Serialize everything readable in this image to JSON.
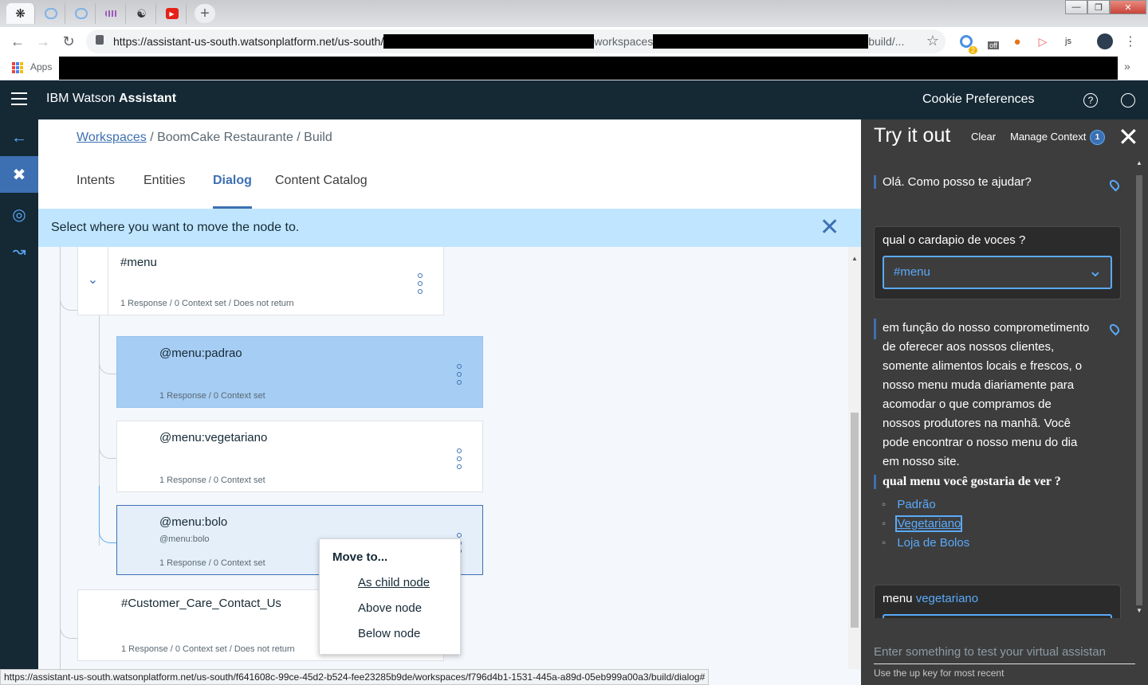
{
  "browser": {
    "url_host": "https://assistant-us-south.watsonplatform.net/us-south/",
    "url_mid": "workspaces",
    "url_tail": "build/...",
    "bookmarks_apps": "Apps",
    "ext_badge": "2",
    "ext_off": "off",
    "ext_js": "js",
    "status_url": "https://assistant-us-south.watsonplatform.net/us-south/f641608c-99ce-45d2-b524-fee23285b9de/workspaces/f796d4b1-1531-445a-a89d-05eb999a00a3/build/dialog#"
  },
  "header": {
    "brand_light": "IBM Watson",
    "brand_bold": "Assistant",
    "cookie": "Cookie Preferences"
  },
  "breadcrumb": {
    "link": "Workspaces",
    "rest": "/ BoomCake Restaurante / Build"
  },
  "tabs": [
    "Intents",
    "Entities",
    "Dialog",
    "Content Catalog"
  ],
  "banner": "Select where you want to move the node to.",
  "nodes": {
    "menu": {
      "name": "#menu",
      "meta": "1 Response / 0 Context set / Does not return"
    },
    "padrao": {
      "name": "@menu:padrao",
      "meta": "1 Response / 0 Context set"
    },
    "vegetariano": {
      "name": "@menu:vegetariano",
      "meta": "1 Response / 0 Context set"
    },
    "bolo": {
      "name": "@menu:bolo",
      "sub": "@menu:bolo",
      "meta": "1 Response / 0 Context set"
    },
    "care": {
      "name": "#Customer_Care_Contact_Us",
      "meta": "1 Response / 0 Context set / Does not return"
    }
  },
  "move_menu": {
    "title": "Move to...",
    "items": [
      "As child node",
      "Above node",
      "Below node"
    ]
  },
  "try_panel": {
    "title": "Try it out",
    "clear": "Clear",
    "manage": "Manage Context",
    "context_count": "1",
    "greeting": "Olá. Como posso te ajudar?",
    "user_msg": "qual o cardapio de voces ?",
    "intent": "#menu",
    "reply": "em função do nosso comprometimento de oferecer aos nossos clientes, somente alimentos locais e frescos, o nosso menu muda diariamente para acomodar o que compramos de nossos produtores na manhã. Você pode encontrar o nosso menu do dia em nosso site.",
    "question": "qual menu você gostaria de ver ?",
    "options": [
      "Padrão",
      "Vegetariano",
      "Loja de Bolos"
    ],
    "user_msg2_a": "menu",
    "user_msg2_b": "vegetariano",
    "input_placeholder": "Enter something to test your virtual assistan",
    "input_hint": "Use the up key for most recent"
  },
  "colors": {
    "header_bg": "#152935",
    "accent": "#3d70b2",
    "banner_bg": "#c0e6ff",
    "panel_bg": "#3d3d3d",
    "link": "#5aaafa"
  }
}
